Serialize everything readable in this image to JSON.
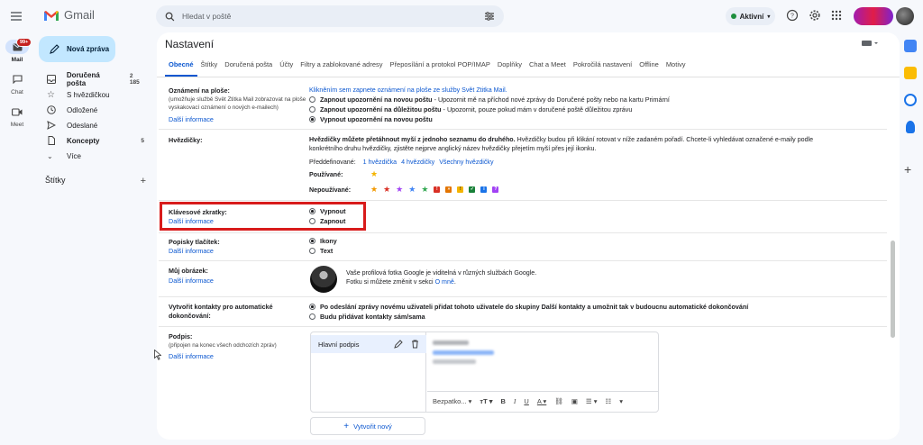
{
  "app": {
    "name": "Gmail"
  },
  "search": {
    "placeholder": "Hledat v poště"
  },
  "status": {
    "label": "Aktivní",
    "color": "#1e8e3e"
  },
  "rail": {
    "mail": {
      "label": "Mail",
      "badge": "99+"
    },
    "chat": {
      "label": "Chat"
    },
    "meet": {
      "label": "Meet"
    }
  },
  "compose": {
    "label": "Nová zpráva"
  },
  "sidebar": {
    "items": [
      {
        "label": "Doručená pošta",
        "count": "2 185",
        "icon": "inbox-icon",
        "bold": true
      },
      {
        "label": "S hvězdičkou",
        "count": "",
        "icon": "star-icon"
      },
      {
        "label": "Odložené",
        "count": "",
        "icon": "clock-icon"
      },
      {
        "label": "Odeslané",
        "count": "",
        "icon": "send-icon"
      },
      {
        "label": "Koncepty",
        "count": "5",
        "icon": "draft-icon",
        "bold": true
      },
      {
        "label": "Více",
        "count": "",
        "icon": "chevron-down-icon"
      }
    ],
    "labels_heading": "Štítky",
    "labels_add": "+"
  },
  "settings": {
    "title": "Nastavení",
    "tabs": [
      "Obecné",
      "Štítky",
      "Doručená pošta",
      "Účty",
      "Filtry a zablokované adresy",
      "Přeposílání a protokol POP/IMAP",
      "Doplňky",
      "Chat a Meet",
      "Pokročilá nastavení",
      "Offline",
      "Motivy"
    ],
    "active_tab": "Obecné",
    "desktop_notifications": {
      "label": "Oznámení na ploše:",
      "sub": "(umožňuje službě Svět Ztitka Mail zobrazovat na ploše vyskakovací oznámení o nových e-mailech)",
      "more": "Další informace",
      "enable_link": "Klikněním sem zapnete oznámení na ploše ze služby Svět Ztitka Mail.",
      "options": [
        {
          "title": "Zapnout upozornění na novou poštu",
          "desc": " - Upozornit mě na příchod nové zprávy do Doručené pošty nebo na kartu Primární",
          "selected": false
        },
        {
          "title": "Zapnout upozornění na důležitou poštu",
          "desc": " - Upozornit, pouze pokud mám v doručené poště důležitou zprávu",
          "selected": false
        },
        {
          "title": "Vypnout upozornění na novou poštu",
          "desc": "",
          "selected": true
        }
      ]
    },
    "stars": {
      "label": "Hvězdičky:",
      "desc_bold": "Hvězdičky můžete přetáhnout myší z jednoho seznamu do druhého.",
      "desc_line1": " Hvězdičky budou při klikání rotovat v níže zadaném pořadí. Chcete-li vyhledávat označené e-maily podle",
      "desc_line2": "konkrétního druhu hvězdičky, zjistěte nejprve anglický název hvězdičky přejetím myší přes její ikonku.",
      "presets_label": "Předdefinované:",
      "presets": [
        "1 hvězdička",
        "4 hvězdičky",
        "Všechny hvězdičky"
      ],
      "used_label": "Používané:",
      "unused_label": "Nepoužívané:"
    },
    "shortcuts": {
      "label": "Klávesové zkratky:",
      "more": "Další informace",
      "options": [
        {
          "title": "Vypnout",
          "selected": true
        },
        {
          "title": "Zapnout",
          "selected": false
        }
      ]
    },
    "button_labels": {
      "label": "Popisky tlačítek:",
      "more": "Další informace",
      "options": [
        {
          "title": "Ikony",
          "selected": true
        },
        {
          "title": "Text",
          "selected": false
        }
      ]
    },
    "my_picture": {
      "label": "Můj obrázek:",
      "more": "Další informace",
      "line1": "Vaše profilová fotka Google je viditelná v různých službách Google.",
      "line2": "Fotku si můžete změnit v sekci ",
      "link": "O mně",
      "line2_end": "."
    },
    "auto_contacts": {
      "label_line1": "Vytvořit kontakty pro automatické",
      "label_line2": "dokončování:",
      "options": [
        {
          "title": "Po odeslání zprávy novému uživateli přidat tohoto uživatele do skupiny Další kontakty a umožnit tak v budoucnu automatické dokončování",
          "selected": true
        },
        {
          "title": "Budu přidávat kontakty sám/sama",
          "selected": false
        }
      ]
    },
    "signature": {
      "label": "Podpis:",
      "sub": "(připojen na konec všech odchozích zpráv)",
      "more": "Další informace",
      "item": "Hlavní podpis",
      "font": "Bezpatko...",
      "new_button": "Vytvořit nový"
    }
  },
  "colors": {
    "accent": "#0b57d0",
    "highlight": "#d81b1b",
    "compose_bg": "#c2e7ff"
  }
}
